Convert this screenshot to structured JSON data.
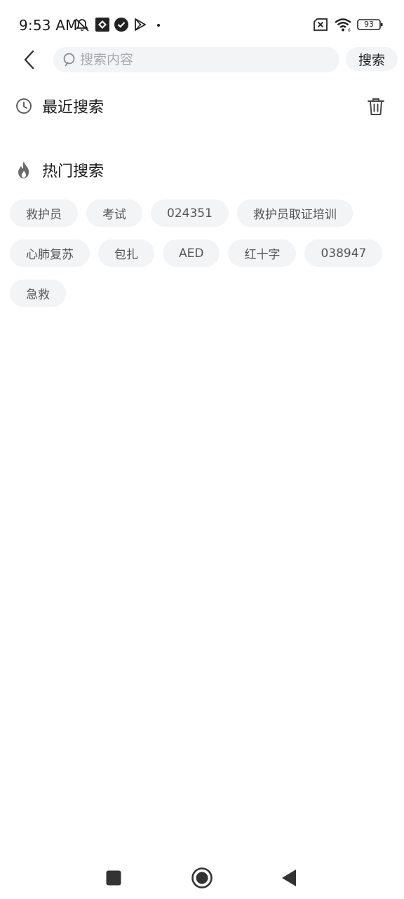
{
  "status_bar": {
    "time": "9:53 AM",
    "battery": "93",
    "icons": [
      "mute-bell-icon",
      "sync-icon",
      "check-badge-icon",
      "play-store-icon",
      "dot-icon",
      "no-sim-icon",
      "wifi-icon",
      "battery-icon"
    ]
  },
  "search": {
    "placeholder": "搜索内容",
    "value": "",
    "button_label": "搜索"
  },
  "recent": {
    "title": "最近搜索",
    "items": []
  },
  "hot": {
    "title": "热门搜索",
    "rows": [
      [
        "救护员",
        "考试",
        "024351",
        "救护员取证培训"
      ],
      [
        "心肺复苏",
        "包扎",
        "AED",
        "红十字",
        "038947"
      ],
      [
        "急救"
      ]
    ]
  },
  "colors": {
    "chip_bg": "#f3f4f6",
    "chip_text": "#555555",
    "accent_fire": "#6b6b6b"
  }
}
